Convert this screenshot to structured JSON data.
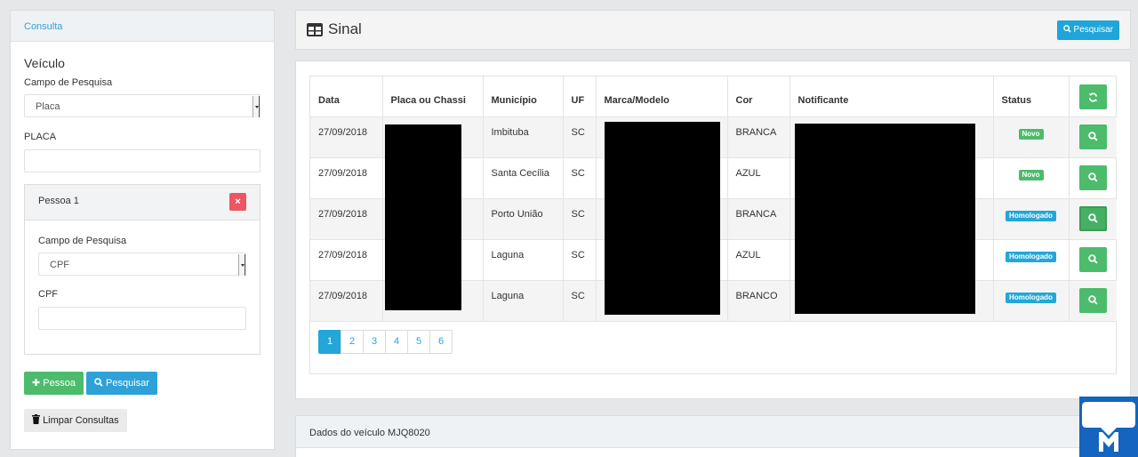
{
  "sidebar": {
    "header": "Consulta",
    "section_title": "Veículo",
    "campo_label": "Campo de Pesquisa",
    "campo_value": "Placa",
    "placa_label": "PLACA",
    "placa_value": "",
    "pessoa": {
      "title": "Pessoa 1",
      "remove_label": "×",
      "campo_label": "Campo de Pesquisa",
      "campo_value": "CPF",
      "cpf_label": "CPF",
      "cpf_value": ""
    },
    "add_pessoa_label": "Pessoa",
    "pesquisar_label": "Pesquisar",
    "limpar_label": "Limpar Consultas"
  },
  "header": {
    "title": "Sinal",
    "pesquisar_label": "Pesquisar"
  },
  "table": {
    "columns": [
      "Data",
      "Placa ou Chassi",
      "Município",
      "UF",
      "Marca/Modelo",
      "Cor",
      "Notificante",
      "Status"
    ],
    "rows": [
      {
        "data": "27/09/2018",
        "placa": "",
        "municipio": "Imbituba",
        "uf": "SC",
        "marca": "",
        "cor": "BRANCA",
        "notificante": "",
        "status": "Novo",
        "status_color": "#4cbb6c"
      },
      {
        "data": "27/09/2018",
        "placa": "",
        "municipio": "Santa Cecília",
        "uf": "SC",
        "marca": "",
        "cor": "AZUL",
        "notificante": "",
        "status": "Novo",
        "status_color": "#4cbb6c"
      },
      {
        "data": "27/09/2018",
        "placa": "",
        "municipio": "Porto União",
        "uf": "SC",
        "marca": "",
        "cor": "BRANCA",
        "notificante": "",
        "status": "Homologado",
        "status_color": "#22a7d8"
      },
      {
        "data": "27/09/2018",
        "placa": "",
        "municipio": "Laguna",
        "uf": "SC",
        "marca": "",
        "cor": "AZUL",
        "notificante": "",
        "status": "Homologado",
        "status_color": "#22a7d8"
      },
      {
        "data": "27/09/2018",
        "placa": "",
        "municipio": "Laguna",
        "uf": "SC",
        "marca": "",
        "cor": "BRANCO",
        "notificante": "",
        "status": "Homologado",
        "status_color": "#22a7d8"
      }
    ],
    "pages": [
      "1",
      "2",
      "3",
      "4",
      "5",
      "6"
    ],
    "current_page": "1"
  },
  "details": {
    "title": "Dados do veículo MJQ8020"
  },
  "colors": {
    "accent": "#22a7d8",
    "success": "#4cbb6c",
    "danger": "#ed5565"
  }
}
